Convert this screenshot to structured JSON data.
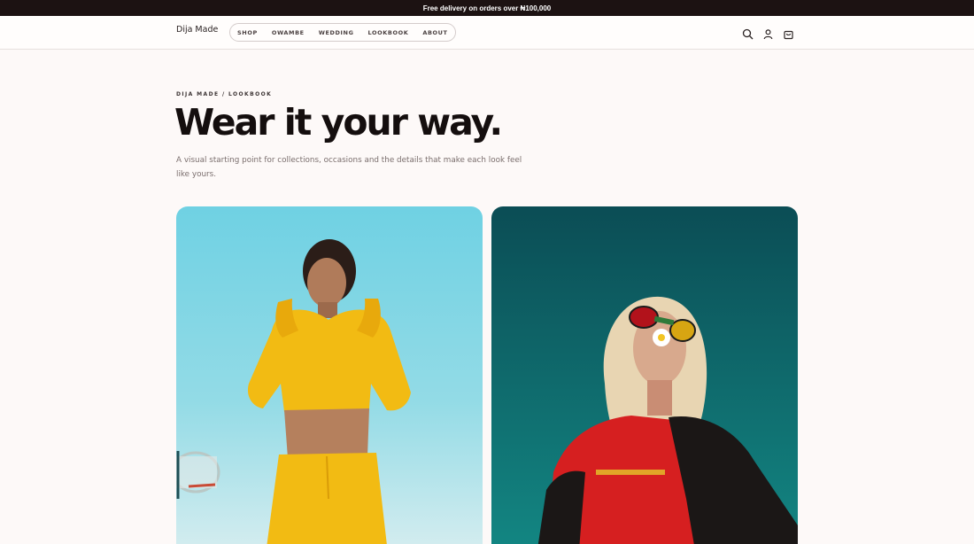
{
  "promo": {
    "text": "Free delivery on orders over ₦100,000"
  },
  "header": {
    "logo": "Dija Made",
    "nav": [
      {
        "label": "SHOP"
      },
      {
        "label": "OWAMBE"
      },
      {
        "label": "WEDDING"
      },
      {
        "label": "LOOKBOOK"
      },
      {
        "label": "ABOUT"
      }
    ],
    "icons": [
      "search-icon",
      "account-icon",
      "bag-icon"
    ]
  },
  "hero": {
    "breadcrumb": "DIJA MADE / LOOKBOOK",
    "title": "Wear it your way.",
    "subtitle": "A visual starting point for collections, occasions and the details that make each look feel like yours."
  },
  "lookbook": {
    "cards": [
      {
        "bg_top": "#6fd1e3",
        "outfit_color": "#f2bb13"
      },
      {
        "bg_top": "#0b4d55",
        "outfit_color": "#d61f20"
      }
    ]
  }
}
